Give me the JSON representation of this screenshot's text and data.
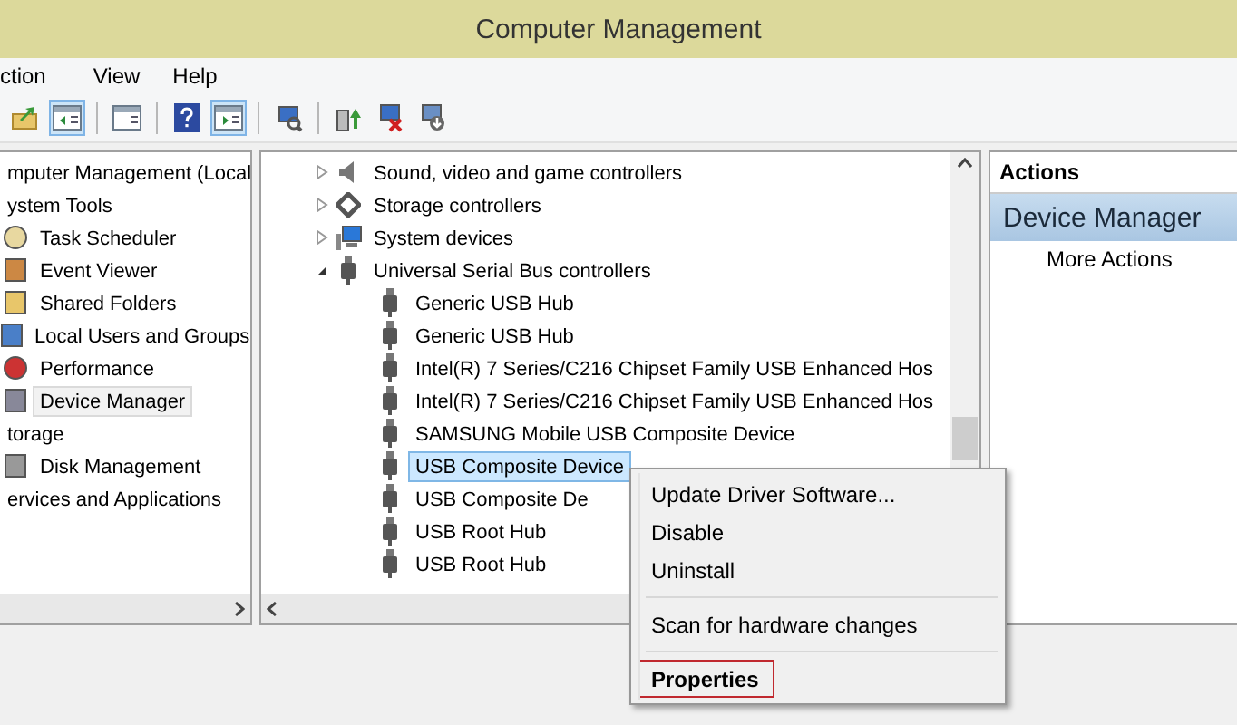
{
  "window": {
    "title": "Computer Management"
  },
  "menu": [
    "ction",
    "View",
    "Help"
  ],
  "toolbar": [
    {
      "kind": "up",
      "pressed": false
    },
    {
      "kind": "panel-left",
      "pressed": true
    },
    {
      "kind": "sep"
    },
    {
      "kind": "list",
      "pressed": false
    },
    {
      "kind": "sep"
    },
    {
      "kind": "help",
      "pressed": false
    },
    {
      "kind": "panel-right",
      "pressed": true
    },
    {
      "kind": "sep"
    },
    {
      "kind": "scan",
      "pressed": false
    },
    {
      "kind": "sep"
    },
    {
      "kind": "update",
      "pressed": false
    },
    {
      "kind": "remove",
      "pressed": false
    },
    {
      "kind": "install",
      "pressed": false
    }
  ],
  "left_tree": [
    {
      "label": "mputer Management (Local",
      "children": [
        {
          "label": "ystem Tools",
          "children": [
            {
              "label": "Task Scheduler",
              "kind": "clock",
              "selected": false
            },
            {
              "label": "Event Viewer",
              "kind": "log",
              "selected": false
            },
            {
              "label": "Shared Folders",
              "kind": "folder",
              "selected": false
            },
            {
              "label": "Local Users and Groups",
              "kind": "users",
              "selected": false
            },
            {
              "label": "Performance",
              "kind": "gauge",
              "selected": false
            },
            {
              "label": "Device Manager",
              "kind": "device",
              "selected": true
            }
          ]
        },
        {
          "label": "torage",
          "children": [
            {
              "label": "Disk Management",
              "kind": "disk",
              "selected": false
            }
          ]
        },
        {
          "label": "ervices and Applications"
        }
      ]
    }
  ],
  "device_tree": [
    {
      "label": "Sound, video and game controllers",
      "kind": "sound",
      "expanded": false
    },
    {
      "label": "Storage controllers",
      "kind": "storage",
      "expanded": false
    },
    {
      "label": "System devices",
      "kind": "system",
      "expanded": false
    },
    {
      "label": "Universal Serial Bus controllers",
      "kind": "usb",
      "expanded": true,
      "children": [
        {
          "label": "Generic USB Hub",
          "selected": false
        },
        {
          "label": "Generic USB Hub",
          "selected": false
        },
        {
          "label": "Intel(R) 7 Series/C216 Chipset Family USB Enhanced Hos",
          "selected": false
        },
        {
          "label": "Intel(R) 7 Series/C216 Chipset Family USB Enhanced Hos",
          "selected": false
        },
        {
          "label": "SAMSUNG Mobile USB Composite Device",
          "selected": false
        },
        {
          "label": "USB Composite Device",
          "selected": true
        },
        {
          "label": "USB Composite De",
          "selected": false
        },
        {
          "label": "USB Root Hub",
          "selected": false
        },
        {
          "label": "USB Root Hub",
          "selected": false
        }
      ]
    }
  ],
  "actions": {
    "header": "Actions",
    "section": "Device Manager",
    "items": [
      "More Actions"
    ]
  },
  "context_menu": [
    {
      "kind": "item",
      "label": "Update Driver Software...",
      "default": false,
      "focused": false
    },
    {
      "kind": "item",
      "label": "Disable",
      "default": false,
      "focused": false
    },
    {
      "kind": "item",
      "label": "Uninstall",
      "default": false,
      "focused": false
    },
    {
      "kind": "separator"
    },
    {
      "kind": "item",
      "label": "Scan for hardware changes",
      "default": false,
      "focused": false
    },
    {
      "kind": "separator"
    },
    {
      "kind": "item",
      "label": "Properties",
      "default": true,
      "focused": true
    }
  ]
}
